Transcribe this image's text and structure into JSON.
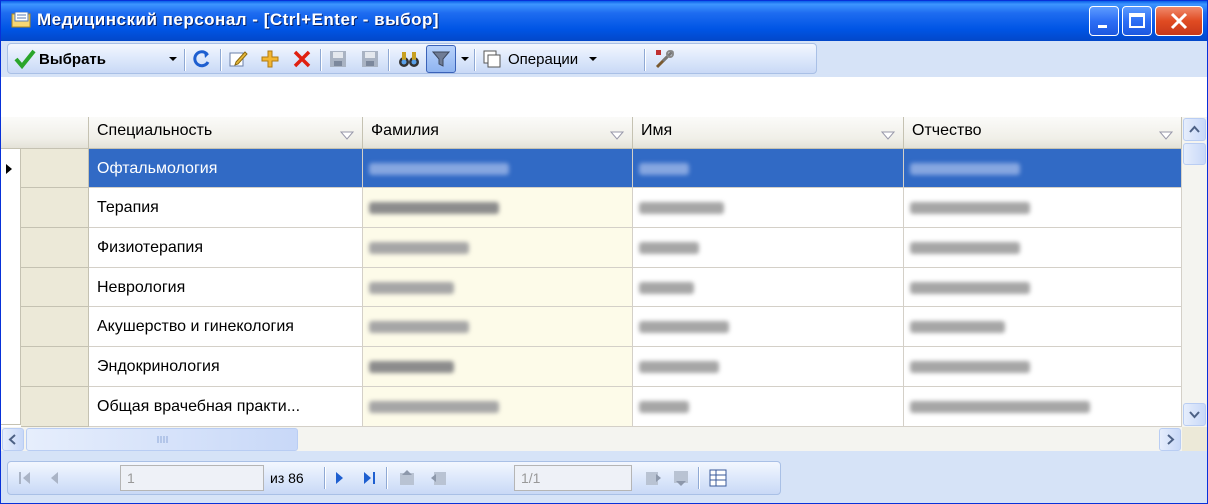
{
  "window": {
    "title": "Медицинский персонал - [Ctrl+Enter - выбор]",
    "icon": "folder-list-icon",
    "buttons": [
      "minimize-icon",
      "maximize-icon",
      "close-icon"
    ]
  },
  "toolbar": {
    "select_label": "Выбрать",
    "operations_label": "Операции",
    "icons": [
      "check-icon",
      "refresh-icon",
      "edit-icon",
      "add-icon",
      "delete-icon",
      "save-icon",
      "save-disabled-icon",
      "binoculars-icon",
      "filter-icon",
      "copy-icon",
      "tools-icon"
    ]
  },
  "grid": {
    "columns": [
      "Специальность",
      "Фамилия",
      "Имя",
      "Отчество"
    ],
    "rows": [
      {
        "speciality": "Офтальмология",
        "selected": true
      },
      {
        "speciality": "Терапия"
      },
      {
        "speciality": "Физиотерапия"
      },
      {
        "speciality": "Неврология"
      },
      {
        "speciality": "Акушерство и гинекология"
      },
      {
        "speciality": "Эндокринология"
      },
      {
        "speciality": "Общая врачебная практи..."
      }
    ]
  },
  "navigator": {
    "record_value": "1",
    "of_text": "из 86",
    "page_value": "1/1"
  },
  "colors": {
    "titlebar": "#0055e5",
    "selection": "#316ac5",
    "toolbar_bg": "#d6e3f7",
    "cream_column": "#fdfbe9"
  }
}
